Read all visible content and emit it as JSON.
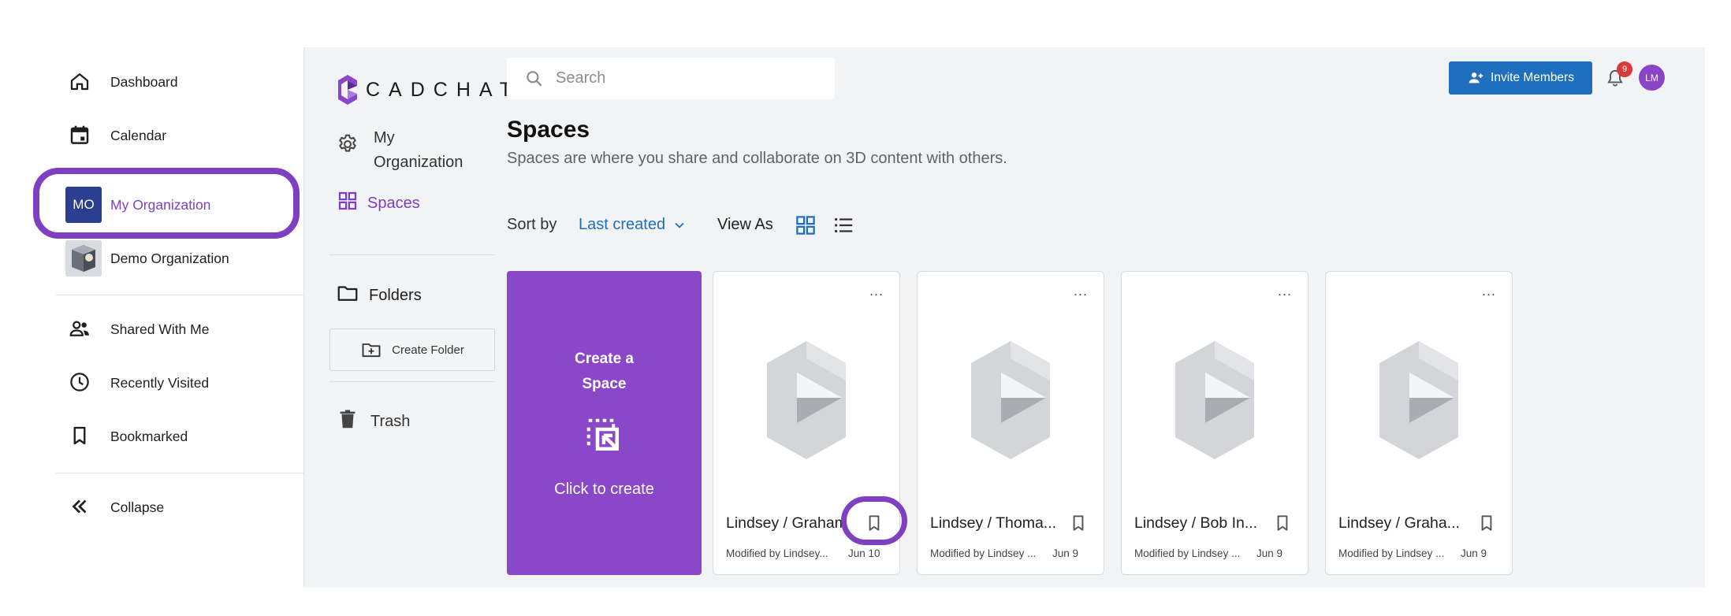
{
  "left_nav": {
    "items": [
      {
        "label": "Dashboard",
        "icon": "home-icon"
      },
      {
        "label": "Calendar",
        "icon": "calendar-icon"
      }
    ],
    "orgs": [
      {
        "initials": "MO",
        "label": "My Organization",
        "color": "#2c3e8f",
        "active": true
      },
      {
        "label": "Demo Organization"
      }
    ],
    "items2": [
      {
        "label": "Shared With Me",
        "icon": "people-icon"
      },
      {
        "label": "Recently Visited",
        "icon": "clock-icon"
      },
      {
        "label": "Bookmarked",
        "icon": "bookmark-icon"
      }
    ],
    "collapse_label": "Collapse"
  },
  "app": {
    "logo_text": "CADCHAT",
    "sidebar": {
      "org_label": "My Organization",
      "spaces_label": "Spaces",
      "folders_label": "Folders",
      "create_folder_label": "Create Folder",
      "trash_label": "Trash"
    },
    "search": {
      "placeholder": "Search"
    },
    "invite_label": "Invite Members",
    "notification_count": "9",
    "avatar_initials": "LM",
    "title": "Spaces",
    "subtitle": "Spaces are where you share and collaborate on 3D content with others.",
    "sort_by_label": "Sort by",
    "sort_value": "Last created",
    "view_as_label": "View As",
    "create_card": {
      "title": "Create a Space",
      "cta": "Click to create"
    },
    "spaces": [
      {
        "name": "Lindsey / Graham",
        "modified": "Modified by Lindsey...",
        "date": "Jun 10"
      },
      {
        "name": "Lindsey / Thoma...",
        "modified": "Modified by Lindsey ...",
        "date": "Jun 9"
      },
      {
        "name": "Lindsey / Bob In...",
        "modified": "Modified by Lindsey ...",
        "date": "Jun 9"
      },
      {
        "name": "Lindsey / Graha...",
        "modified": "Modified by Lindsey ...",
        "date": "Jun 9"
      }
    ],
    "more_label": "...",
    "colors": {
      "accent": "#8a48c9",
      "primary_blue": "#1f6fbf",
      "highlight": "#7f3fc1"
    }
  }
}
